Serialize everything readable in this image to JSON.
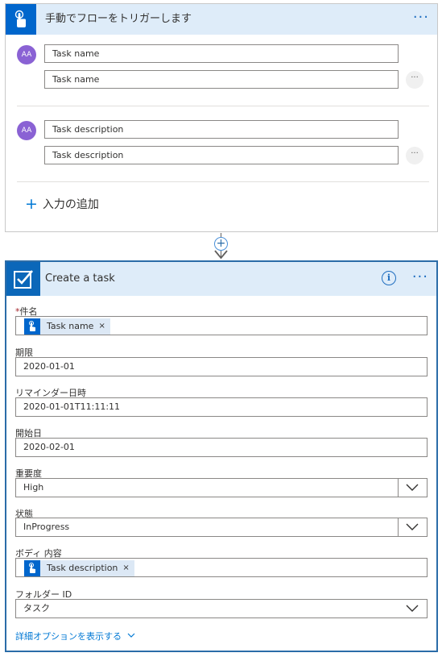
{
  "trigger": {
    "title": "手動でフローをトリガーします",
    "menu_label": "···",
    "inputs": [
      {
        "avatar_text": "AA",
        "name_value": "Task name",
        "desc_value": "Task name",
        "more_label": "···"
      },
      {
        "avatar_text": "AA",
        "name_value": "Task description",
        "desc_value": "Task description",
        "more_label": "···"
      }
    ],
    "add_input_label": "入力の追加",
    "add_plus": "+"
  },
  "connector": {
    "add_label": "+"
  },
  "action": {
    "title": "Create a task",
    "info_label": "i",
    "menu_label": "···",
    "fields": {
      "subject": {
        "required_mark": "*",
        "label": "件名",
        "token": "Task name",
        "token_remove": "×"
      },
      "due": {
        "label": "期限",
        "value": "2020-01-01"
      },
      "reminder": {
        "label": "リマインダー日時",
        "value": "2020-01-01T11:11:11"
      },
      "start": {
        "label": "開始日",
        "value": "2020-02-01"
      },
      "importance": {
        "label": "重要度",
        "value": "High"
      },
      "status": {
        "label": "状態",
        "value": "InProgress"
      },
      "body": {
        "label": "ボディ 内容",
        "token": "Task description",
        "token_remove": "×"
      },
      "folder": {
        "label": "フォルダー ID",
        "value": "タスク"
      }
    },
    "advanced_label": "詳細オプションを表示する"
  },
  "colors": {
    "accent": "#0078d4",
    "header_bg": "#deecf9",
    "trigger_tile": "#0066cc",
    "avatar": "#8a62d4",
    "active_border": "#2b6ca8"
  },
  "icons": {
    "trigger": "hand-touch-icon",
    "task": "checkbox-icon",
    "info": "info-icon",
    "chevron": "chevron-down-icon"
  }
}
